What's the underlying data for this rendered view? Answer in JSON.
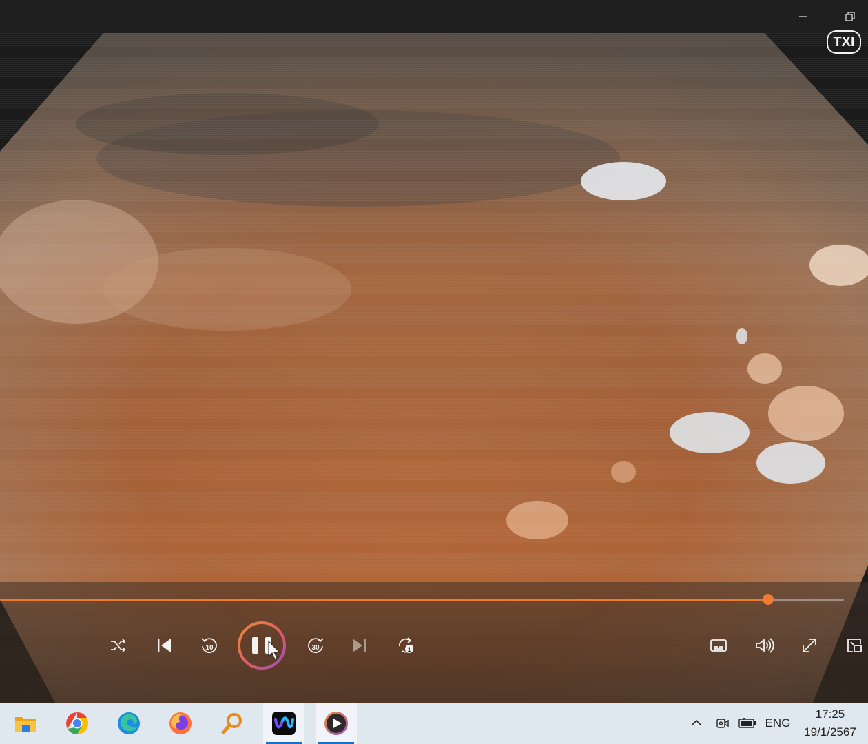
{
  "window": {
    "video_overlay_text": "TXI",
    "playback_progress": 0.91,
    "accent_color": "#ec7a33"
  },
  "controls": {
    "left": [
      {
        "name": "shuffle-button",
        "icon": "shuffle-icon"
      },
      {
        "name": "previous-button",
        "icon": "skip-previous-icon"
      },
      {
        "name": "rewind-10-button",
        "icon": "rewind-10-icon",
        "label": "10"
      },
      {
        "name": "play-pause-button",
        "icon": "pause-icon"
      },
      {
        "name": "forward-30-button",
        "icon": "forward-30-icon",
        "label": "30"
      },
      {
        "name": "next-button",
        "icon": "skip-next-icon"
      },
      {
        "name": "repeat-one-button",
        "icon": "repeat-one-icon",
        "label": "1"
      }
    ],
    "right": [
      {
        "name": "subtitles-button",
        "icon": "subtitles-icon"
      },
      {
        "name": "volume-button",
        "icon": "volume-icon"
      },
      {
        "name": "fullscreen-button",
        "icon": "fullscreen-icon"
      },
      {
        "name": "mini-player-button",
        "icon": "mini-player-icon"
      }
    ]
  },
  "taskbar": {
    "apps": [
      {
        "name": "file-explorer",
        "icon": "folder-icon"
      },
      {
        "name": "chrome",
        "icon": "chrome-icon"
      },
      {
        "name": "edge",
        "icon": "edge-icon"
      },
      {
        "name": "firefox",
        "icon": "firefox-icon"
      },
      {
        "name": "search",
        "icon": "magnifier-icon"
      },
      {
        "name": "webex",
        "icon": "webex-icon"
      },
      {
        "name": "media-player",
        "icon": "media-player-icon"
      }
    ],
    "tray": {
      "language": "ENG",
      "time": "17:25",
      "date": "19/1/2567"
    }
  }
}
